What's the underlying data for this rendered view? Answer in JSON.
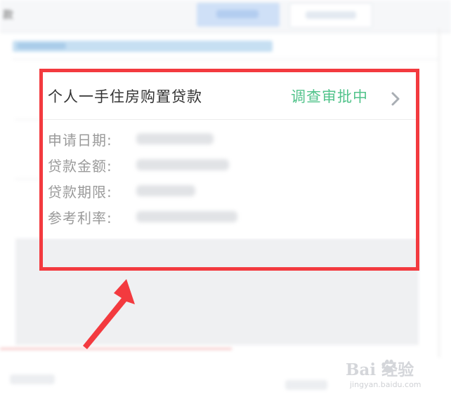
{
  "background": {
    "top_left_char": "款"
  },
  "loan": {
    "title": "个人一手住房购置贷款",
    "status": "调查审批中",
    "fields": [
      {
        "label": "申请日期:",
        "value_hidden": true
      },
      {
        "label": "贷款金额:",
        "value_hidden": true
      },
      {
        "label": "贷款期限:",
        "value_hidden": true
      },
      {
        "label": "参考利率:",
        "value_hidden": true
      }
    ]
  },
  "watermark": {
    "logo": "Bai 经验",
    "url": "jingyan.baidu.com"
  },
  "colors": {
    "status": "#52c38b",
    "highlight": "#f33a3f",
    "label": "#9a9a9a",
    "title": "#333333"
  },
  "icons": [
    "chevron-right-icon",
    "annotation-arrow-icon",
    "baidu-paw-icon"
  ]
}
